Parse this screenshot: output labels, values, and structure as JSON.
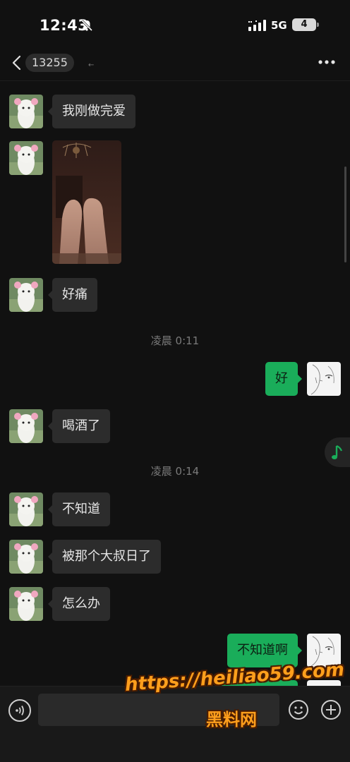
{
  "status_bar": {
    "time": "12:43",
    "network": "5G",
    "battery": "4"
  },
  "nav": {
    "title": "13255",
    "arrow": "←"
  },
  "messages": [
    {
      "side": "in",
      "text": "我刚做完爱"
    },
    {
      "side": "in",
      "type": "image"
    },
    {
      "side": "in",
      "text": "好痛"
    },
    {
      "type": "time",
      "text": "凌晨 0:11"
    },
    {
      "side": "out",
      "text": "好"
    },
    {
      "side": "in",
      "text": "喝酒了"
    },
    {
      "type": "time",
      "text": "凌晨 0:14"
    },
    {
      "side": "in",
      "text": "不知道"
    },
    {
      "side": "in",
      "text": "被那个大叔日了"
    },
    {
      "side": "in",
      "text": "怎么办"
    },
    {
      "side": "out",
      "text": "不知道啊"
    }
  ],
  "watermark": {
    "line1": "https://heiliao59.com",
    "line2": "黑料网"
  },
  "icons": {
    "bell": "bell-slash-icon",
    "signal": "signal-icon",
    "back": "back-icon",
    "more": "more-icon",
    "voice": "voice-icon",
    "emoji": "emoji-icon",
    "add": "plus-icon",
    "music": "music-note-icon"
  },
  "colors": {
    "background": "#111111",
    "bubble_in": "#2c2c2c",
    "bubble_out": "#1aad5a"
  }
}
